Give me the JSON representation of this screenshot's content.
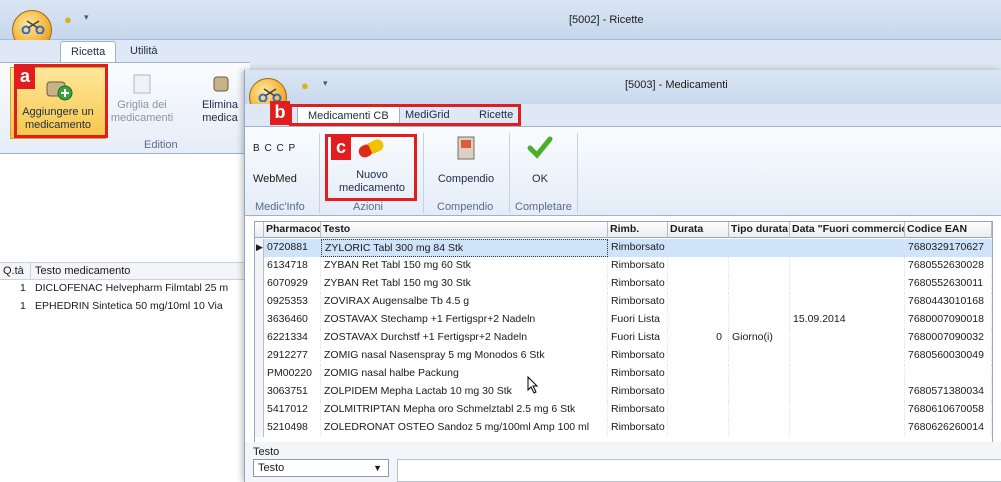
{
  "outer": {
    "title": "[5002] - Ricette",
    "tabs": [
      "Ricetta",
      "Utilità"
    ],
    "ribbon": {
      "add_label_1": "Aggiungere un",
      "add_label_2": "medicamento",
      "grid_label_1": "Griglia dei",
      "grid_label_2": "medicamenti",
      "delete_label_1": "Elimina",
      "delete_label_2": "medica",
      "group": "Edition"
    },
    "list": {
      "headers": [
        "Q.tà",
        "Testo medicamento"
      ],
      "rows": [
        {
          "qty": "1",
          "text": "DICLOFENAC Helvepharm Filmtabl 25 m"
        },
        {
          "qty": "1",
          "text": "EPHEDRIN Sintetica 50 mg/10ml 10 Via"
        }
      ]
    }
  },
  "inner": {
    "title": "[5003] - Medicamenti",
    "tabs": [
      "Medicamenti CB",
      "MediGrid",
      "Ricette"
    ],
    "ribbon": {
      "bccp": "B C C P",
      "webmed": "WebMed",
      "medicinfo": "Medic'Info",
      "nuovo_1": "Nuovo",
      "nuovo_2": "medicamento",
      "azioni": "Azioni",
      "compendio": "Compendio",
      "compendio_group": "Compendio",
      "ok": "OK",
      "completare": "Completare"
    },
    "grid": {
      "headers": [
        "Pharmacode",
        "Testo",
        "Rimb.",
        "Durata",
        "Tipo durata",
        "Data \"Fuori commercio\"",
        "Codice EAN"
      ],
      "rows": [
        [
          "0720881",
          "ZYLORIC Tabl 300 mg 84 Stk",
          "Rimborsato",
          "",
          "",
          "",
          "7680329170627"
        ],
        [
          "6134718",
          "ZYBAN Ret Tabl 150 mg 60 Stk",
          "Rimborsato",
          "",
          "",
          "",
          "7680552630028"
        ],
        [
          "6070929",
          "ZYBAN Ret Tabl 150 mg 30 Stk",
          "Rimborsato",
          "",
          "",
          "",
          "7680552630011"
        ],
        [
          "0925353",
          "ZOVIRAX Augensalbe Tb 4.5 g",
          "Rimborsato",
          "",
          "",
          "",
          "7680443010168"
        ],
        [
          "3636460",
          "ZOSTAVAX Stechamp +1 Fertigspr+2 Nadeln",
          "Fuori Lista",
          "",
          "",
          "15.09.2014",
          "7680007090018"
        ],
        [
          "6221334",
          "ZOSTAVAX Durchstf +1 Fertigspr+2 Nadeln",
          "Fuori Lista",
          "0",
          "Giorno(i)",
          "",
          "7680007090032"
        ],
        [
          "2912277",
          "ZOMIG nasal Nasenspray 5 mg Monodos 6 Stk",
          "Rimborsato",
          "",
          "",
          "",
          "7680560030049"
        ],
        [
          "PM00220",
          "ZOMIG nasal halbe Packung",
          "Rimborsato",
          "",
          "",
          "",
          ""
        ],
        [
          "3063751",
          "ZOLPIDEM Mepha Lactab 10 mg 30 Stk",
          "Rimborsato",
          "",
          "",
          "",
          "7680571380034"
        ],
        [
          "5417012",
          "ZOLMITRIPTAN Mepha oro Schmelztabl 2.5 mg 6 Stk",
          "Rimborsato",
          "",
          "",
          "",
          "7680610670058"
        ],
        [
          "5210498",
          "ZOLEDRONAT OSTEO Sandoz 5 mg/100ml Amp 100 ml",
          "Rimborsato",
          "",
          "",
          "",
          "7680626260014"
        ]
      ]
    },
    "filter_label": "Testo",
    "filter_select": "Testo"
  },
  "markers": {
    "a": "a",
    "b": "b",
    "c": "c"
  },
  "colors": {
    "highlight": "#e21d1d",
    "selection": "#cfe3fb",
    "ok_check": "#4caf2a"
  }
}
